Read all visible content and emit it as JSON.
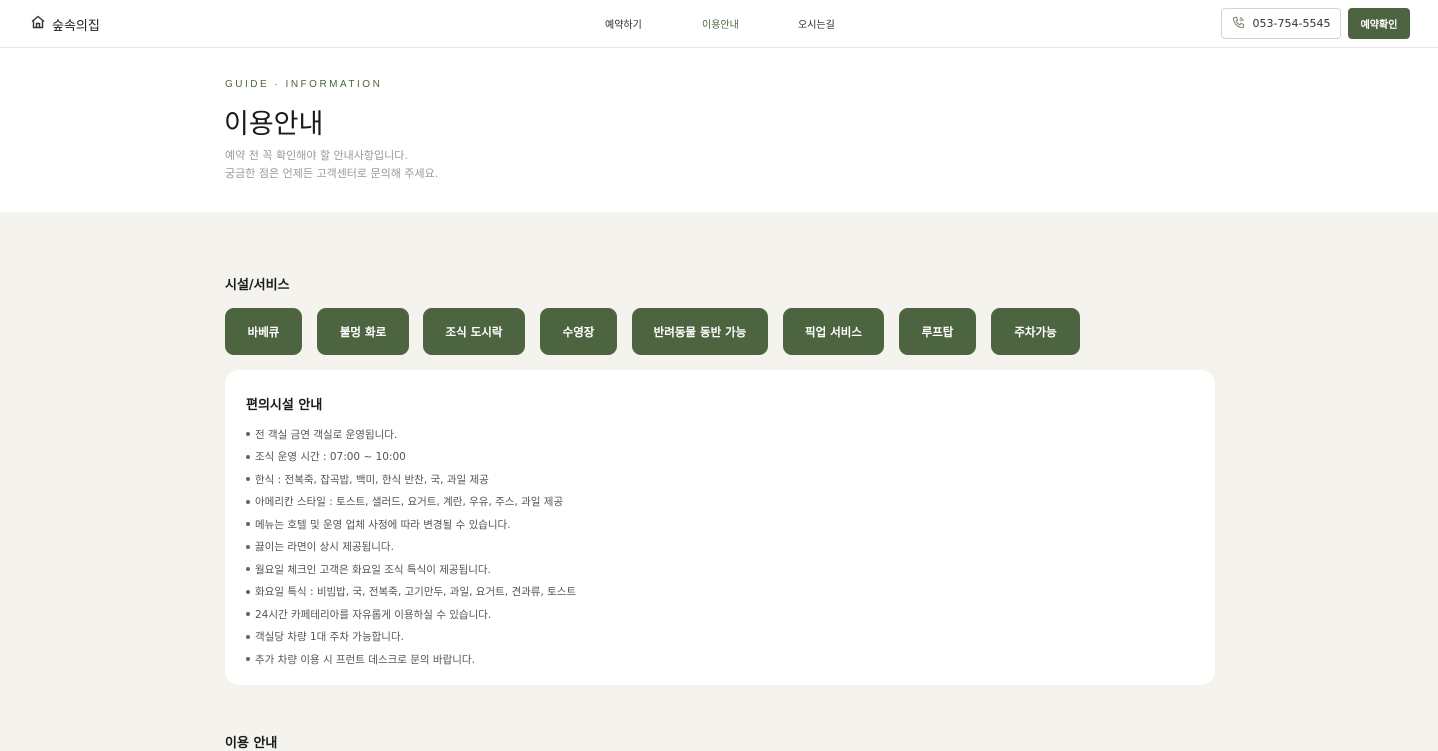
{
  "header": {
    "logo_text": "숲속의집",
    "nav": [
      {
        "label": "예약하기",
        "active": false
      },
      {
        "label": "이용안내",
        "active": true
      },
      {
        "label": "오시는길",
        "active": false
      }
    ],
    "phone": "053-754-5545",
    "confirm_label": "예약확인"
  },
  "hero": {
    "eyebrow": "GUIDE · INFORMATION",
    "title": "이용안내",
    "subtitle_1": "예약 전 꼭 확인해야 할 안내사항입니다.",
    "subtitle_2": "궁금한 점은 언제든 고객센터로 문의해 주세요."
  },
  "facilities": {
    "title": "시설/서비스",
    "chips": [
      "바베큐",
      "불멍 화로",
      "조식 도시락",
      "수영장",
      "반려동물 동반 가능",
      "픽업 서비스",
      "루프탑",
      "주차가능"
    ]
  },
  "card": {
    "title": "편의시설 안내",
    "items": [
      "전 객실 금연 객실로 운영됩니다.",
      "조식 운영 시간 : 07:00 ~ 10:00",
      "한식 : 전복죽, 잡곡밥, 백미, 한식 반찬, 국, 과일 제공",
      "아메리칸 스타일 : 토스트, 샐러드, 요거트, 계란, 우유, 주스, 과일 제공",
      "메뉴는 호텔 및 운영 업체 사정에 따라 변경될 수 있습니다.",
      "끓이는 라면이 상시 제공됩니다.",
      "월요일 체크인 고객은 화요일 조식 특식이 제공됩니다.",
      "화요일 특식 : 비빔밥, 국, 전복죽, 고기만두, 과일, 요거트, 견과류, 토스트",
      "24시간 카페테리아를 자유롭게 이용하실 수 있습니다.",
      "객실당 차량 1대 주차 가능합니다.",
      "추가 차량 이용 시 프런트 데스크로 문의 바랍니다."
    ]
  },
  "usage": {
    "title": "이용 안내"
  },
  "colors": {
    "accent": "#4c6540",
    "background": "#f5f3ed"
  },
  "icons": {
    "logo": "home-icon",
    "phone": "phone-icon"
  }
}
